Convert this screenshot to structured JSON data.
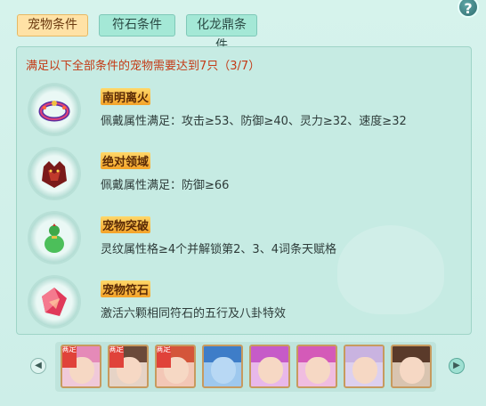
{
  "help_label": "?",
  "tabs": [
    {
      "label": "宠物条件",
      "active": true
    },
    {
      "label": "符石条件",
      "active": false
    },
    {
      "label": "化龙鼎条件",
      "active": false
    }
  ],
  "header": "满足以下全部条件的宠物需要达到7只（3/7）",
  "conditions": [
    {
      "title": "南明离火",
      "desc": "佩戴属性满足：攻击≥53、防御≥40、灵力≥32、速度≥32",
      "icon": "flame-ring-icon"
    },
    {
      "title": "绝对领域",
      "desc": "佩戴属性满足：防御≥66",
      "icon": "demon-armor-icon"
    },
    {
      "title": "宠物突破",
      "desc": "灵纹属性格≥4个并解锁第2、3、4词条天赋格",
      "icon": "gourd-icon"
    },
    {
      "title": "宠物符石",
      "desc": "激活六颗相同符石的五行及八卦特效",
      "icon": "rune-stone-icon"
    }
  ],
  "pets": [
    {
      "badge": "满足",
      "hair": "#e58ab8",
      "name": "pet-pink-girl"
    },
    {
      "badge": "满足",
      "hair": "#6b4a3a",
      "name": "pet-brown-girl"
    },
    {
      "badge": "满足",
      "hair": "#d4553a",
      "name": "pet-red-boy"
    },
    {
      "badge": "",
      "hair": "#3e7dc8",
      "name": "pet-blue-dragon"
    },
    {
      "badge": "",
      "hair": "#c65bc8",
      "name": "pet-purple-girl"
    },
    {
      "badge": "",
      "hair": "#d45ab8",
      "name": "pet-magenta-girl"
    },
    {
      "badge": "",
      "hair": "#c9b3e0",
      "name": "pet-lilac-girl"
    },
    {
      "badge": "",
      "hair": "#5a3a2a",
      "name": "pet-dark-girl"
    }
  ],
  "nav": {
    "prev": "◀",
    "next": "▶"
  }
}
